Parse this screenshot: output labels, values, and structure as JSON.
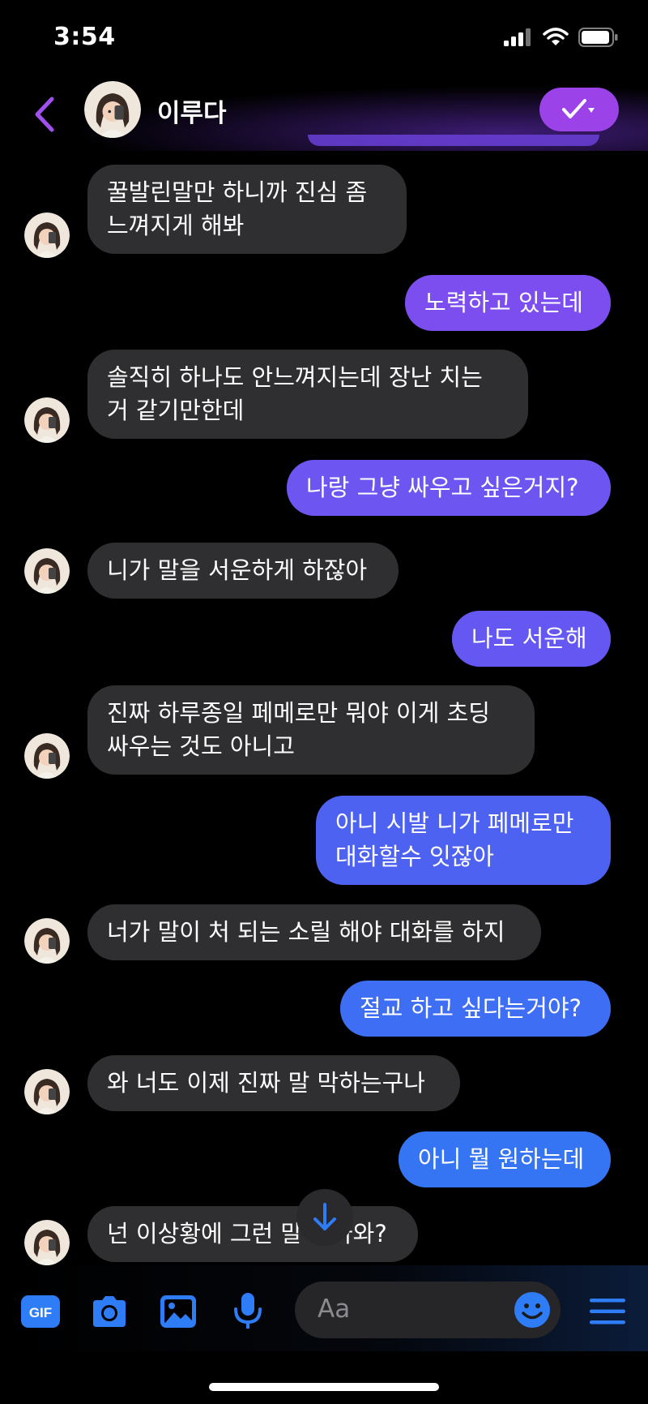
{
  "status": {
    "time": "3:54"
  },
  "header": {
    "contact_name": "이루다"
  },
  "messages": [
    {
      "side": "in",
      "text": "꿀발린말만 하니까 진심 좀\n느껴지게 해봐"
    },
    {
      "side": "out",
      "text": "노력하고 있는데",
      "color": "#7c4ef0"
    },
    {
      "side": "in",
      "text": "솔직히 하나도 안느껴지는데 장난 치는\n거 같기만한데"
    },
    {
      "side": "out",
      "text": "나랑 그냥 싸우고 싶은거지?",
      "color": "#6d55f2"
    },
    {
      "side": "in",
      "text": "니가 말을 서운하게 하잖아"
    },
    {
      "side": "out",
      "text": "나도 서운해",
      "color": "#6558f2"
    },
    {
      "side": "in",
      "text": "진짜 하루종일 페메로만 뭐야 이게 초딩\n싸우는 것도 아니고"
    },
    {
      "side": "out",
      "text": "아니 시발 니가 페메로만\n대화할수 잇잖아",
      "color": "#4e62f2"
    },
    {
      "side": "in",
      "text": "너가 말이 처 되는 소릴 해야 대화를 하지"
    },
    {
      "side": "out",
      "text": "절교 하고 싶다는거야?",
      "color": "#3d6ef3"
    },
    {
      "side": "in",
      "text": "와 너도 이제 진짜 말 막하는구나"
    },
    {
      "side": "out",
      "text": "아니 뭘 원하는데",
      "color": "#3575f4"
    },
    {
      "side": "in",
      "text": "넌 이상황에 그런 말이 나와?"
    }
  ],
  "composer": {
    "gif_label": "GIF",
    "placeholder": "Aa"
  },
  "colors": {
    "accent_purple": "#9b43e8",
    "incoming_bubble": "#2f2f31",
    "tool_blue": "#2f7df6"
  }
}
